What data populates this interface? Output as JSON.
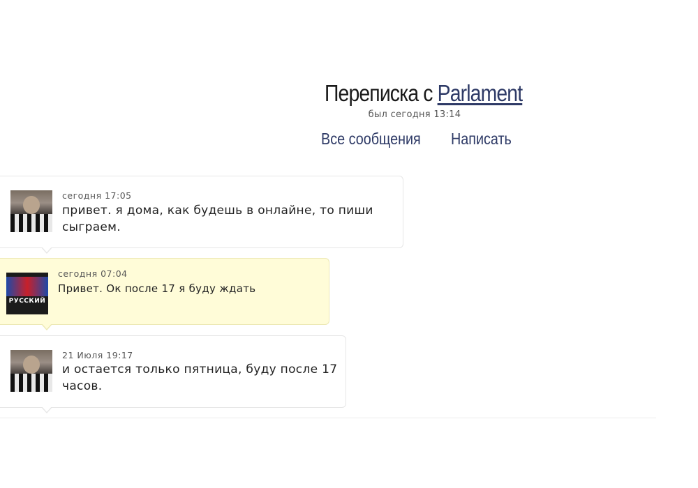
{
  "header": {
    "title_prefix": "Переписка с",
    "contact_name": "Parlament",
    "last_seen": "был сегодня 13:14"
  },
  "nav": {
    "all_messages": "Все сообщения",
    "write": "Написать"
  },
  "messages": [
    {
      "time": "сегодня 17:05",
      "text": "привет. я дома, как будешь в онлайне, то пиши сыграем.",
      "avatar_icon": "user-photo-icon"
    },
    {
      "time": "сегодня 07:04",
      "text": "Привет. Ок после 17 я буду ждать",
      "avatar_icon": "club-logo-icon",
      "avatar_text": "РУССКИЙ"
    },
    {
      "time": "21 Июля 19:17",
      "text": "и остается только пятница, буду после 17 часов.",
      "avatar_icon": "user-photo-icon"
    }
  ],
  "colors": {
    "link": "#2e3a66",
    "own_message_bg": "#fffcd8",
    "message_border": "#e6e6e6"
  }
}
